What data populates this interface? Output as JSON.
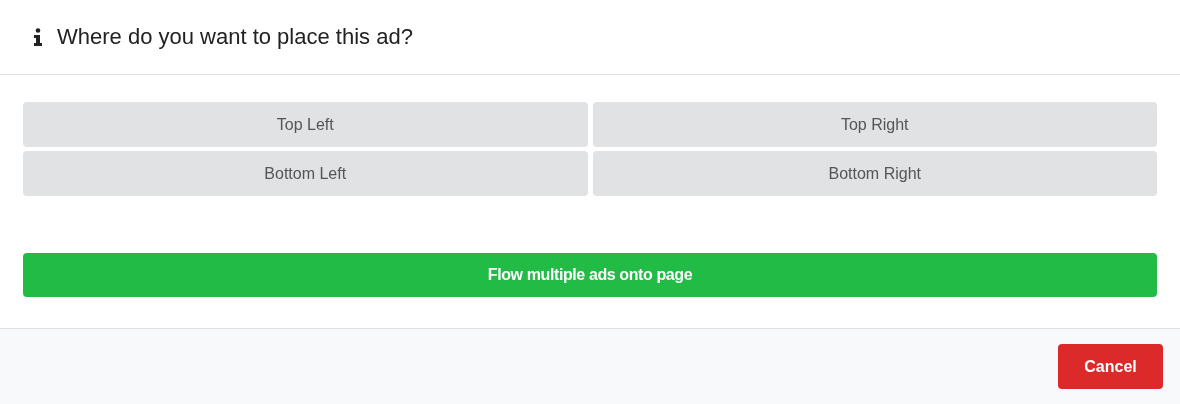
{
  "dialog": {
    "title": "Where do you want to place this ad?",
    "positions": [
      {
        "label": "Top Left"
      },
      {
        "label": "Top Right"
      },
      {
        "label": "Bottom Left"
      },
      {
        "label": "Bottom Right"
      }
    ],
    "flow_button": "Flow multiple ads onto page",
    "cancel_button": "Cancel"
  }
}
